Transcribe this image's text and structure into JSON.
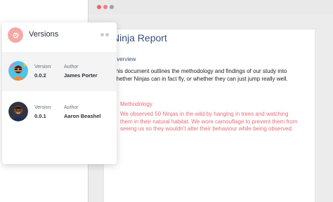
{
  "document": {
    "title": "Ninja Report",
    "section": "Overview",
    "body": "This document outlines the methodology and findings of our study into whether Ninjas can in fact fly, or whether they can just jump really well.",
    "methodology": {
      "title": "Methodology",
      "body": "We observed 50 Ninjas in the wild by hanging in trees and watching them in their natural habitat. We wore camouflage to prevent them from seeing us so they wouldn't alter their behaviour while being observed."
    }
  },
  "panel": {
    "title": "Versions",
    "icon": "history-icon",
    "version_label": "Version",
    "author_label": "Author",
    "items": [
      {
        "version": "0.0.2",
        "author": "James Porter",
        "selected": true
      },
      {
        "version": "0.0.1",
        "author": "Aaron Beashel",
        "selected": false
      }
    ]
  },
  "colors": {
    "accent": "#e66a78",
    "doc_heading": "#3a4f7a",
    "panel_icon_bg": "#f5a9a6"
  }
}
